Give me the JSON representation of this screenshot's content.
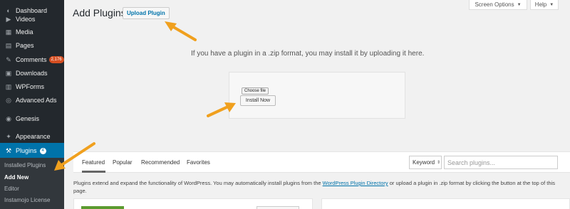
{
  "sidebar": {
    "items": [
      {
        "label": "Dashboard",
        "icon": "dashboard-icon",
        "glyph": "◐"
      },
      {
        "label": "Videos",
        "icon": "video-icon",
        "glyph": "▶"
      },
      {
        "label": "Media",
        "icon": "media-icon",
        "glyph": "▦"
      },
      {
        "label": "Pages",
        "icon": "pages-icon",
        "glyph": "▤"
      },
      {
        "label": "Comments",
        "icon": "comments-icon",
        "glyph": "✎",
        "badge": "2,176"
      },
      {
        "label": "Downloads",
        "icon": "downloads-icon",
        "glyph": "▣"
      },
      {
        "label": "WPForms",
        "icon": "wpforms-icon",
        "glyph": "▥"
      },
      {
        "label": "Advanced Ads",
        "icon": "ads-icon",
        "glyph": "◎"
      },
      {
        "label": "Genesis",
        "icon": "genesis-icon",
        "glyph": "◉"
      },
      {
        "label": "Appearance",
        "icon": "appearance-icon",
        "glyph": "✦"
      }
    ],
    "plugins": {
      "label": "Plugins",
      "badge": "4",
      "glyph": "⚒"
    },
    "submenu": [
      "Installed Plugins",
      "Add New",
      "Editor",
      "Instamojo License"
    ]
  },
  "header": {
    "title": "Add Plugins",
    "upload_label": "Upload Plugin",
    "screen_options": "Screen Options",
    "help": "Help"
  },
  "upload": {
    "help_text": "If you have a plugin in a .zip format, you may install it by uploading it here.",
    "choose_file": "Choose file",
    "install_now": "Install Now"
  },
  "filter": {
    "tabs": [
      "Featured",
      "Popular",
      "Recommended",
      "Favorites"
    ],
    "active_tab": "Featured",
    "keyword_select": "Keyword",
    "search_placeholder": "Search plugins..."
  },
  "description": {
    "before": "Plugins extend and expand the functionality of WordPress. You may automatically install plugins from the ",
    "link": "WordPress Plugin Directory",
    "after": " or upload a plugin in .zip format by clicking the button at the top of this page."
  },
  "colors": {
    "sidebar_bg": "#23282d",
    "accent": "#0073aa",
    "badge": "#d54e21",
    "arrow": "#f0a01e"
  }
}
